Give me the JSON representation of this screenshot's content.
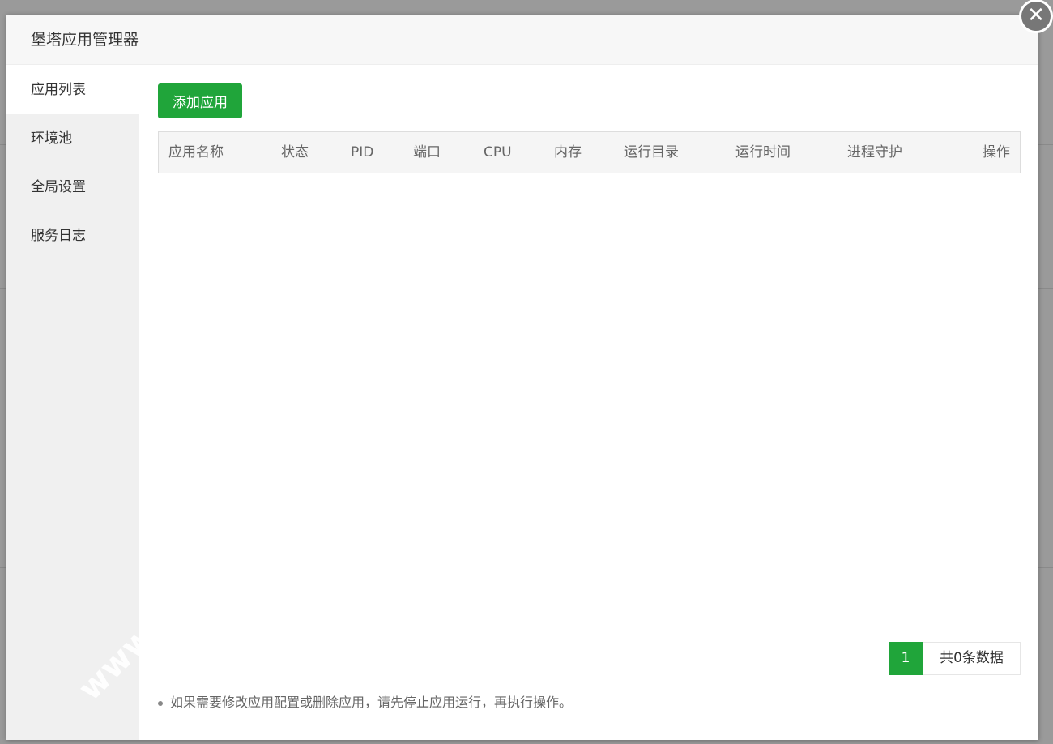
{
  "dialog": {
    "title": "堡塔应用管理器",
    "close_icon": "close-icon"
  },
  "sidebar": {
    "items": [
      {
        "label": "应用列表"
      },
      {
        "label": "环境池"
      },
      {
        "label": "全局设置"
      },
      {
        "label": "服务日志"
      }
    ]
  },
  "toolbar": {
    "add_label": "添加应用"
  },
  "table": {
    "columns": [
      "应用名称",
      "状态",
      "PID",
      "端口",
      "CPU",
      "内存",
      "运行目录",
      "运行时间",
      "进程守护",
      "操作"
    ]
  },
  "pagination": {
    "current": "1",
    "total_text": "共0条数据"
  },
  "note": "如果需要修改应用配置或删除应用，请先停止应用运行，再执行操作。",
  "watermark": "www.",
  "colors": {
    "accent": "#20a53a"
  }
}
